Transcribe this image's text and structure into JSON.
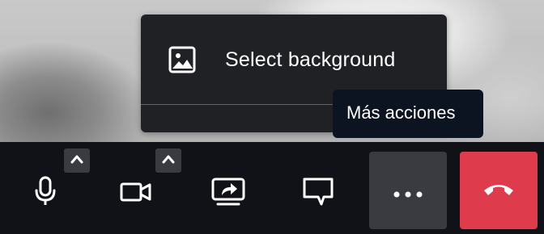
{
  "menu": {
    "items": [
      {
        "label": "Select background",
        "icon": "image-icon"
      }
    ]
  },
  "tooltip": {
    "text": "Más acciones"
  },
  "toolbar": {
    "buttons": [
      {
        "name": "microphone",
        "icon": "microphone-icon",
        "has_options": true
      },
      {
        "name": "camera",
        "icon": "video-camera-icon",
        "has_options": true
      },
      {
        "name": "share-screen",
        "icon": "share-screen-icon"
      },
      {
        "name": "chat",
        "icon": "chat-bubble-icon"
      },
      {
        "name": "more-actions",
        "icon": "more-dots-icon",
        "active": true
      },
      {
        "name": "hang-up",
        "icon": "phone-hangup-icon"
      }
    ]
  },
  "colors": {
    "toolbar_bg": "#111217",
    "menu_bg": "#202124",
    "tooltip_bg": "#0d1421",
    "button_active_bg": "#3a3b40",
    "hangup_bg": "#de3b4d",
    "icon": "#ffffff"
  }
}
